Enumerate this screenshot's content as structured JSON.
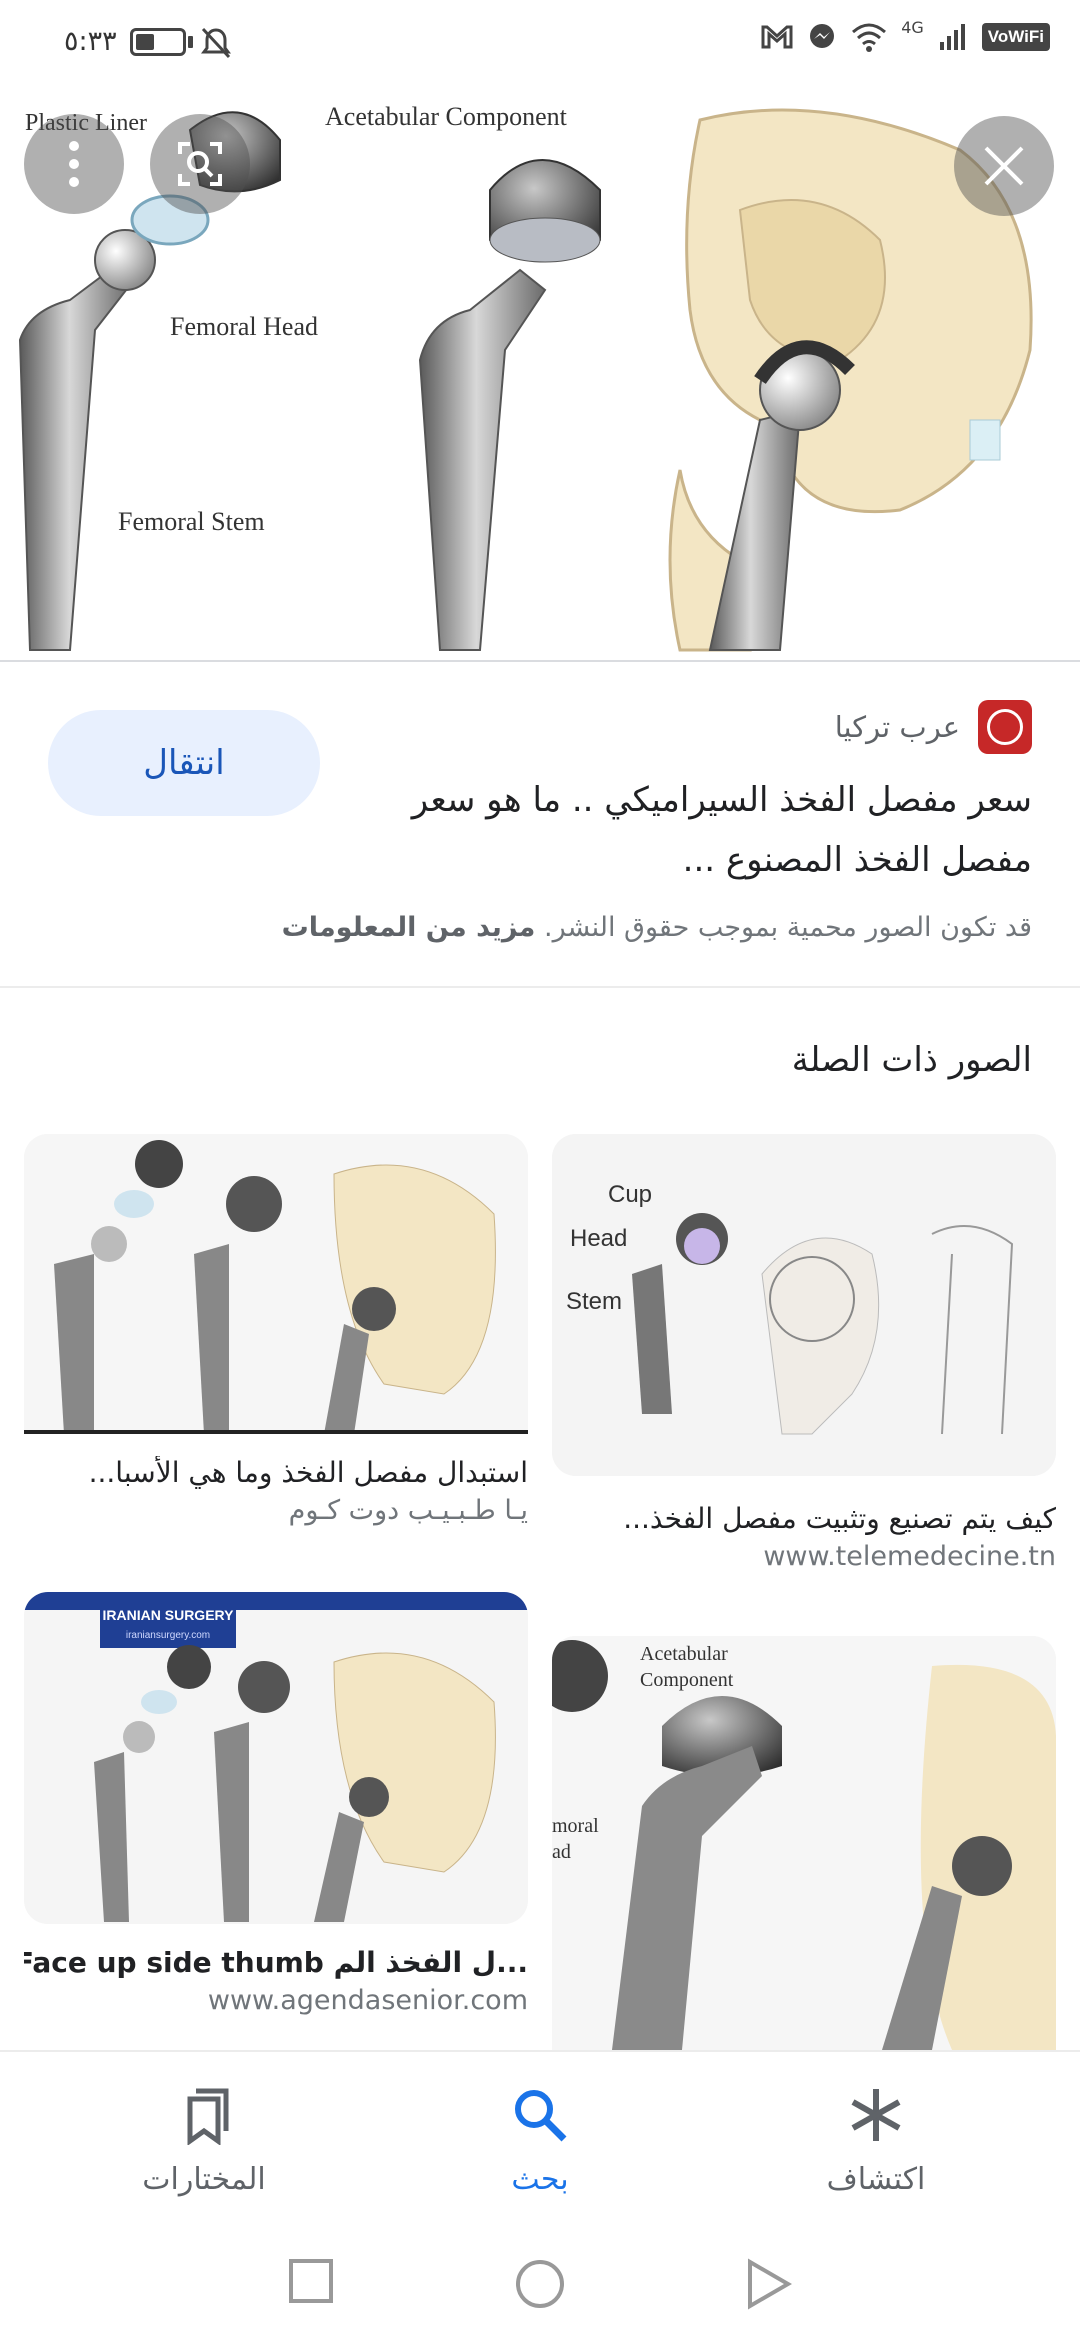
{
  "status_bar": {
    "time": "٥:٣٣",
    "vowifi": "VoWiFi",
    "network": "4G"
  },
  "hero": {
    "labels": {
      "plastic_liner": "Plastic Liner",
      "acetabular_component": "Acetabular Component",
      "femoral_head": "Femoral Head",
      "femoral_stem": "Femoral Stem"
    }
  },
  "info": {
    "source_name": "عرب تركيا",
    "go_button": "انتقال",
    "title": "سعر مفصل الفخذ السيراميكي .. ما هو سعر مفصل الفخذ المصنوع ...",
    "copyright_text": "قد تكون الصور محمية بموجب حقوق النشر.",
    "more_info": "مزيد من المعلومات"
  },
  "related": {
    "heading": "الصور ذات الصلة",
    "items": [
      {
        "title": "كيف يتم تصنيع وتثبيت مفصل الفخذ...",
        "domain": "www.telemedecine.tn",
        "labels": [
          "Cup",
          "Head",
          "Stem"
        ]
      },
      {
        "title": "استبدال مفصل الفخذ وما هي الأسبا...",
        "domain": "يـا طـبـيـب دوت كـوم"
      },
      {
        "title": "Acetabular Component",
        "domain": "",
        "labels": [
          "Acetabular",
          "Component",
          "moral",
          "ad"
        ]
      },
      {
        "title": "...ل الفخذ الم Face up side thumb",
        "domain": "www.agendasenior.com",
        "logo_text": "IRANIAN SURGERY",
        "logo_sub": "iraniansurgery.com"
      }
    ]
  },
  "bottom_nav": {
    "discover": "اكتشاف",
    "search": "بحث",
    "collections": "المختارات"
  },
  "colors": {
    "accent": "#1a73e8",
    "go_button_bg": "#e8f0fe",
    "favicon": "#c62828"
  }
}
